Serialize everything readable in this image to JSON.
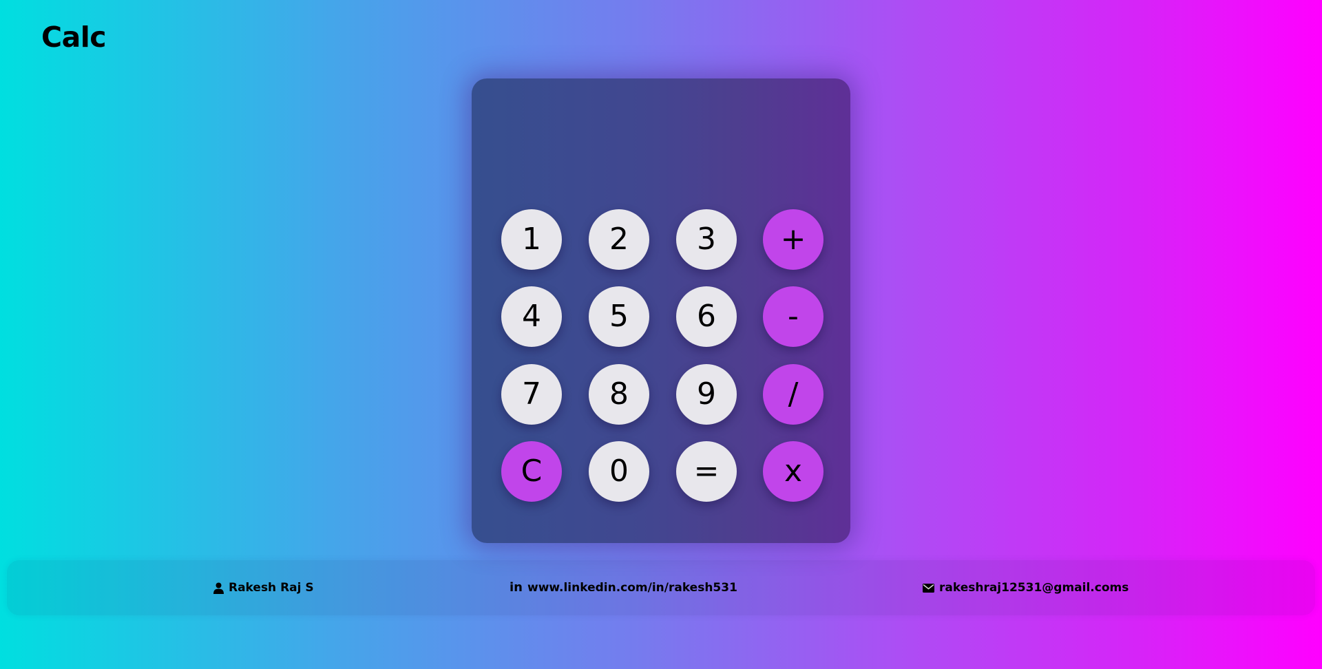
{
  "app": {
    "title": "Calc"
  },
  "display": {
    "value": ""
  },
  "keypad": {
    "keys": [
      {
        "label": "1",
        "kind": "num"
      },
      {
        "label": "2",
        "kind": "num"
      },
      {
        "label": "3",
        "kind": "num"
      },
      {
        "label": "+",
        "kind": "op"
      },
      {
        "label": "4",
        "kind": "num"
      },
      {
        "label": "5",
        "kind": "num"
      },
      {
        "label": "6",
        "kind": "num"
      },
      {
        "label": "-",
        "kind": "op"
      },
      {
        "label": "7",
        "kind": "num"
      },
      {
        "label": "8",
        "kind": "num"
      },
      {
        "label": "9",
        "kind": "num"
      },
      {
        "label": "/",
        "kind": "op"
      },
      {
        "label": "C",
        "kind": "op"
      },
      {
        "label": "0",
        "kind": "num"
      },
      {
        "label": "=",
        "kind": "num"
      },
      {
        "label": "x",
        "kind": "op"
      }
    ]
  },
  "footer": {
    "name": "Rakesh Raj S",
    "name_icon": "user-icon",
    "linkedin_icon_text": "in",
    "linkedin": "www.linkedin.com/in/rakesh531",
    "email": "rakeshraj12531@gmail.coms",
    "email_icon": "envelope-icon"
  },
  "colors": {
    "number_key": "#e8e7ec",
    "operator_key": "#c145ea",
    "background_start": "#00dfe0",
    "background_end": "#ff00ff"
  }
}
